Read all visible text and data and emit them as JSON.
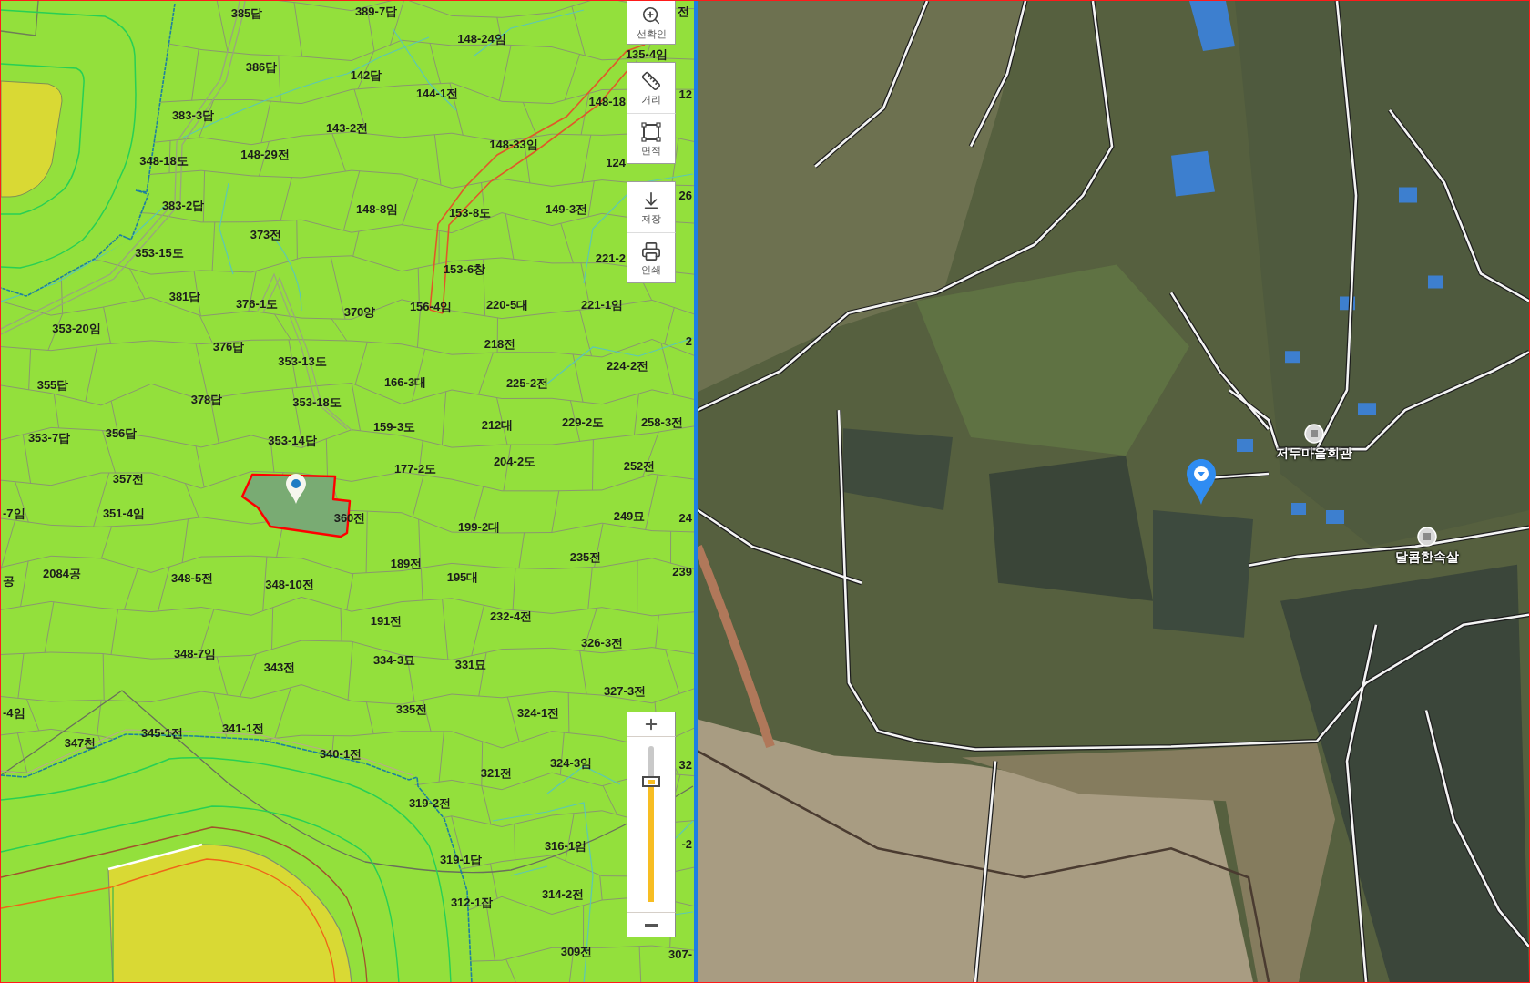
{
  "map": {
    "parcel_labels": [
      "385답",
      "389-7답",
      "전",
      "148-24임",
      "135-4임",
      "386답",
      "142답",
      "144-1전",
      "12",
      "148-18",
      "383-3답",
      "143-2전",
      "148-33임",
      "348-18도",
      "148-29전",
      "124",
      "26",
      "383-2답",
      "148-8임",
      "153-8도",
      "149-3전",
      "373전",
      "353-15도",
      "221-2",
      "153-6창",
      "381답",
      "376-1도",
      "370양",
      "156-4임",
      "220-5대",
      "221-1임",
      "353-20임",
      "376답",
      "218전",
      "2",
      "353-13도",
      "224-2전",
      "355답",
      "166-3대",
      "225-2전",
      "378답",
      "353-18도",
      "159-3도",
      "212대",
      "229-2도",
      "258-3전",
      "353-7답",
      "356답",
      "353-14답",
      "177-2도",
      "204-2도",
      "252전",
      "357전",
      "-7임",
      "351-4임",
      "360전",
      "249묘",
      "24",
      "199-2대",
      "189전",
      "235전",
      "공",
      "2084공",
      "348-5전",
      "348-10전",
      "195대",
      "239",
      "191전",
      "232-4전",
      "326-3전",
      "348-7임",
      "343전",
      "334-3묘",
      "331묘",
      "327-3전",
      "-4임",
      "335전",
      "324-1전",
      "345-1전",
      "341-1전",
      "347천",
      "340-1전",
      "324-3임",
      "32",
      "321전",
      "319-2전",
      "316-1임",
      "-2",
      "319-1답",
      "312-1잡",
      "314-2전",
      "309전",
      "307-"
    ]
  },
  "toolbar": {
    "groups": [
      [
        {
          "label": "선확인"
        }
      ],
      [
        {
          "label": "거리"
        },
        {
          "label": "면적"
        }
      ],
      [
        {
          "label": "저장"
        },
        {
          "label": "인쇄"
        }
      ]
    ]
  },
  "zoom": {
    "level": 0.77
  },
  "satellite": {
    "places": [
      {
        "name": "저두마을회관"
      },
      {
        "name": "달콤한속살"
      }
    ]
  }
}
